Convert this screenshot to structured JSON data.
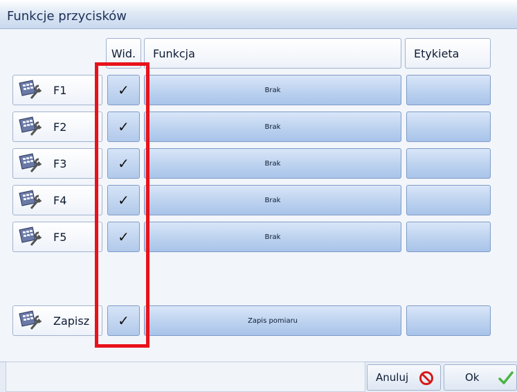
{
  "window": {
    "title": "Funkcje przycisków"
  },
  "columns": {
    "wid": "Wid.",
    "funkcja": "Funkcja",
    "etykieta": "Etykieta"
  },
  "rows": [
    {
      "key": "F1",
      "visible": true,
      "check": "✓",
      "function": "Brak",
      "label": ""
    },
    {
      "key": "F2",
      "visible": true,
      "check": "✓",
      "function": "Brak",
      "label": ""
    },
    {
      "key": "F3",
      "visible": true,
      "check": "✓",
      "function": "Brak",
      "label": ""
    },
    {
      "key": "F4",
      "visible": true,
      "check": "✓",
      "function": "Brak",
      "label": ""
    },
    {
      "key": "F5",
      "visible": true,
      "check": "✓",
      "function": "Brak",
      "label": ""
    }
  ],
  "save_row": {
    "key": "Zapisz",
    "visible": true,
    "check": "✓",
    "function": "Zapis pomiaru",
    "label": ""
  },
  "footer": {
    "cancel": "Anuluj",
    "ok": "Ok"
  },
  "colors": {
    "highlight": "#e8121b",
    "accent": "#bcd2ef",
    "ok_icon": "#4bb543",
    "cancel_icon": "#d51a1a"
  },
  "icons": {
    "row_icon": "keyboard-wrench-icon",
    "cancel_icon": "prohibited-icon",
    "ok_icon": "checkmark-icon"
  }
}
